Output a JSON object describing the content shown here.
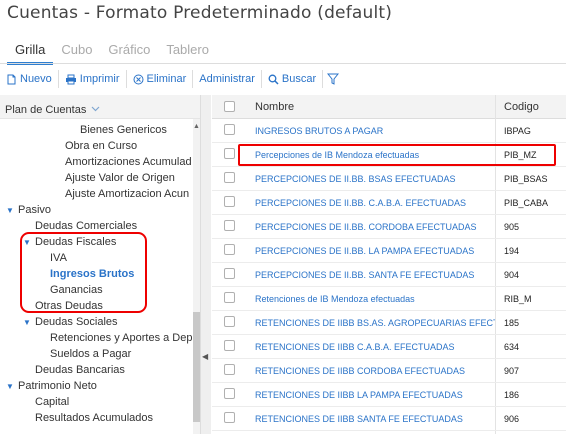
{
  "page": {
    "title": "Cuentas - Formato Predeterminado (default)"
  },
  "tabs": [
    {
      "label": "Grilla"
    },
    {
      "label": "Cubo"
    },
    {
      "label": "Gráfico"
    },
    {
      "label": "Tablero"
    }
  ],
  "toolbar": {
    "nuevo": "Nuevo",
    "imprimir": "Imprimir",
    "eliminar": "Eliminar",
    "administrar": "Administrar",
    "buscar": "Buscar"
  },
  "tree": {
    "header": "Plan de Cuentas",
    "items": [
      {
        "label": "Bienes Genericos"
      },
      {
        "label": "Obra en Curso"
      },
      {
        "label": "Amortizaciones Acumulad"
      },
      {
        "label": "Ajuste Valor de Origen"
      },
      {
        "label": "Ajuste Amortizacion Acun"
      },
      {
        "label": "Pasivo"
      },
      {
        "label": "Deudas Comerciales"
      },
      {
        "label": "Deudas Fiscales"
      },
      {
        "label": "IVA"
      },
      {
        "label": "Ingresos Brutos"
      },
      {
        "label": "Ganancias"
      },
      {
        "label": "Otras Deudas"
      },
      {
        "label": "Deudas Sociales"
      },
      {
        "label": "Retenciones y Aportes a Dep"
      },
      {
        "label": "Sueldos a Pagar"
      },
      {
        "label": "Deudas Bancarias"
      },
      {
        "label": "Patrimonio Neto"
      },
      {
        "label": "Capital"
      },
      {
        "label": "Resultados Acumulados"
      }
    ]
  },
  "grid": {
    "columns": {
      "nombre": "Nombre",
      "codigo": "Codigo"
    },
    "rows": [
      {
        "nombre": "INGRESOS BRUTOS A PAGAR",
        "codigo": "IBPAG"
      },
      {
        "nombre": "Percepciones de IB Mendoza efectuadas",
        "codigo": "PIB_MZ"
      },
      {
        "nombre": "PERCEPCIONES DE II.BB. BSAS EFECTUADAS",
        "codigo": "PIB_BSAS"
      },
      {
        "nombre": "PERCEPCIONES DE II.BB. C.A.B.A. EFECTUADAS",
        "codigo": "PIB_CABA"
      },
      {
        "nombre": "PERCEPCIONES DE II.BB. CORDOBA EFECTUADAS",
        "codigo": "905"
      },
      {
        "nombre": "PERCEPCIONES DE II.BB. LA PAMPA EFECTUADAS",
        "codigo": "194"
      },
      {
        "nombre": "PERCEPCIONES DE II.BB. SANTA FE EFECTUADAS",
        "codigo": "904"
      },
      {
        "nombre": "Retenciones de IB Mendoza efectuadas",
        "codigo": "RIB_M"
      },
      {
        "nombre": "RETENCIONES DE IIBB BS.AS. AGROPECUARIAS EFECTUADAS",
        "codigo": "185"
      },
      {
        "nombre": "RETENCIONES DE IIBB C.A.B.A. EFECTUADAS",
        "codigo": "634"
      },
      {
        "nombre": "RETENCIONES DE IIBB CORDOBA EFECTUADAS",
        "codigo": "907"
      },
      {
        "nombre": "RETENCIONES DE IIBB LA PAMPA EFECTUADAS",
        "codigo": "186"
      },
      {
        "nombre": "RETENCIONES DE IIBB SANTA FE EFECTUADAS",
        "codigo": "906"
      }
    ]
  },
  "colors": {
    "accent": "#2a73c8",
    "highlight": "#e00000"
  }
}
